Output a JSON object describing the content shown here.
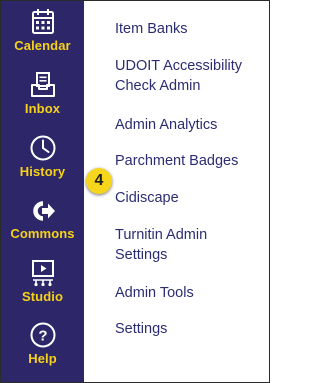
{
  "sidebar": {
    "bg_color": "#2d2769",
    "label_color": "#f7d117",
    "items": [
      {
        "label": "Calendar",
        "icon": "calendar-icon"
      },
      {
        "label": "Inbox",
        "icon": "inbox-icon"
      },
      {
        "label": "History",
        "icon": "clock-icon"
      },
      {
        "label": "Commons",
        "icon": "commons-arrow-icon"
      },
      {
        "label": "Studio",
        "icon": "studio-icon"
      },
      {
        "label": "Help",
        "icon": "question-icon"
      }
    ]
  },
  "menu": {
    "link_color": "#2b2d72",
    "items": [
      {
        "lines": [
          "Item Banks"
        ]
      },
      {
        "lines": [
          "UDOIT Accessibility",
          "Check Admin"
        ]
      },
      {
        "lines": [
          "Admin Analytics"
        ]
      },
      {
        "lines": [
          "Parchment Badges"
        ]
      },
      {
        "lines": [
          "Cidiscape"
        ]
      },
      {
        "lines": [
          "Turnitin Admin",
          "Settings"
        ]
      },
      {
        "lines": [
          "Admin Tools"
        ]
      },
      {
        "lines": [
          "Settings"
        ]
      }
    ]
  },
  "step_badge": {
    "label": "4",
    "color": "#f5d61c"
  }
}
